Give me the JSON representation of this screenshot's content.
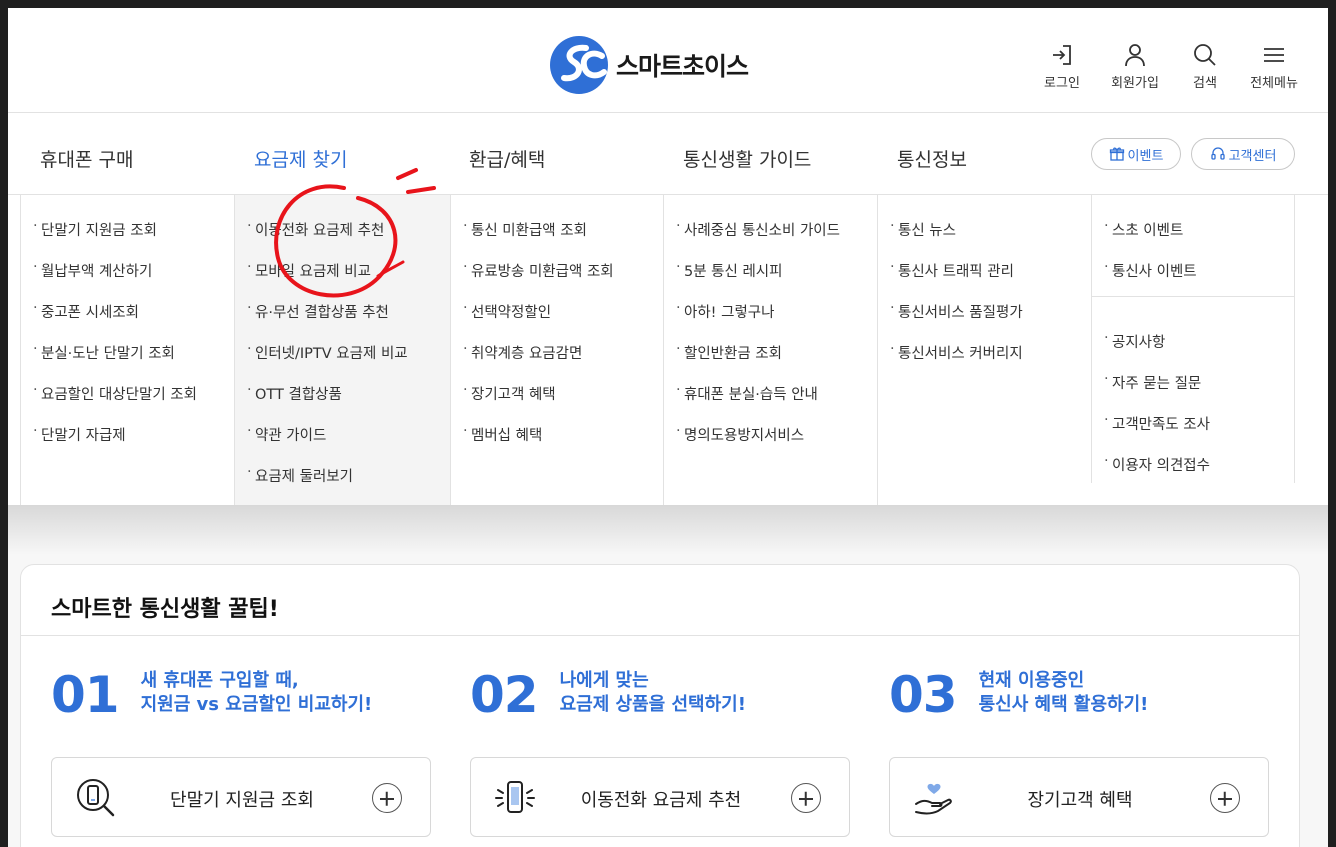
{
  "header": {
    "logo_text": "스마트초이스",
    "logo_mark": "SC",
    "util": [
      {
        "label": "로그인",
        "icon": "login-icon"
      },
      {
        "label": "회원가입",
        "icon": "person-icon"
      },
      {
        "label": "검색",
        "icon": "search-icon"
      },
      {
        "label": "전체메뉴",
        "icon": "hamburger-icon"
      }
    ]
  },
  "gnb": {
    "items": [
      "휴대폰 구매",
      "요금제 찾기",
      "환급/혜택",
      "통신생활 가이드",
      "통신정보"
    ],
    "active_index": 1,
    "event_pill": "이벤트",
    "cs_pill": "고객센터"
  },
  "mega": {
    "col1": [
      "단말기 지원금 조회",
      "월납부액 계산하기",
      "중고폰 시세조회",
      "분실·도난 단말기 조회",
      "요금할인 대상단말기 조회",
      "단말기 자급제"
    ],
    "col2": [
      "이동전화 요금제 추천",
      "모바일 요금제 비교",
      "유·무선 결합상품 추천",
      "인터넷/IPTV 요금제 비교",
      "OTT 결합상품",
      "약관 가이드",
      "요금제 둘러보기"
    ],
    "col3": [
      "통신 미환급액 조회",
      "유료방송 미환급액 조회",
      "선택약정할인",
      "취약계층 요금감면",
      "장기고객 혜택",
      "멤버십 혜택"
    ],
    "col4": [
      "사례중심 통신소비 가이드",
      "5분 통신 레시피",
      "아하! 그렇구나",
      "할인반환금 조회",
      "휴대폰 분실·습득 안내",
      "명의도용방지서비스"
    ],
    "col5": [
      "통신 뉴스",
      "통신사 트래픽 관리",
      "통신서비스 품질평가",
      "통신서비스 커버리지"
    ],
    "col6a": [
      "스초 이벤트",
      "통신사 이벤트"
    ],
    "col6b": [
      "공지사항",
      "자주 묻는 질문",
      "고객만족도 조사",
      "이용자 의견접수"
    ]
  },
  "tips": {
    "title": "스마트한 통신생활 꿀팁!",
    "items": [
      {
        "num": "01",
        "line1": "새 휴대폰 구입할 때,",
        "line2": "지원금 vs 요금할인 비교하기!",
        "box_label": "단말기 지원금 조회",
        "icon": "phone-search-icon"
      },
      {
        "num": "02",
        "line1": "나에게 맞는",
        "line2": "요금제 상품을 선택하기!",
        "box_label": "이동전화 요금제 추천",
        "icon": "phone-ring-icon"
      },
      {
        "num": "03",
        "line1": "현재 이용중인",
        "line2": "통신사 혜택 활용하기!",
        "box_label": "장기고객 혜택",
        "icon": "heart-hand-icon"
      }
    ]
  },
  "colors": {
    "accent": "#2f6fd6",
    "annotation": "#e8141b"
  }
}
